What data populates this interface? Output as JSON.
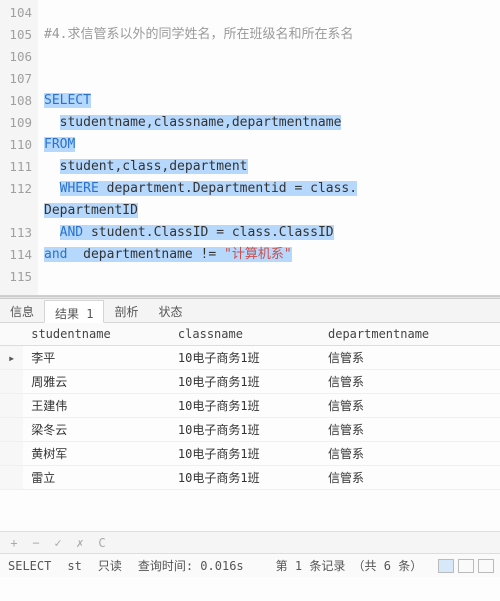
{
  "editor": {
    "lines": [
      {
        "n": 104,
        "tokens": []
      },
      {
        "n": 105,
        "tokens": [
          {
            "t": "#4.求信管系以外的同学姓名，所在班级名和所在系名",
            "cls": "comment"
          }
        ]
      },
      {
        "n": 106,
        "tokens": []
      },
      {
        "n": 107,
        "tokens": []
      },
      {
        "n": 108,
        "tokens": [
          {
            "t": "SELECT",
            "cls": "sel kw"
          }
        ]
      },
      {
        "n": 109,
        "tokens": [
          {
            "t": "  ",
            "cls": ""
          },
          {
            "t": "studentname,classname,departmentname",
            "cls": "sel"
          }
        ]
      },
      {
        "n": 110,
        "tokens": [
          {
            "t": "FROM",
            "cls": "sel kw"
          }
        ]
      },
      {
        "n": 111,
        "tokens": [
          {
            "t": "  ",
            "cls": ""
          },
          {
            "t": "student,class,department",
            "cls": "sel"
          }
        ]
      },
      {
        "n": 112,
        "tokens": [
          {
            "t": "  ",
            "cls": ""
          },
          {
            "t": "WHERE",
            "cls": "sel kw"
          },
          {
            "t": " department.Departmentid = class.",
            "cls": "sel"
          }
        ],
        "wrap": [
          {
            "t": "DepartmentID",
            "cls": "sel"
          }
        ]
      },
      {
        "n": 113,
        "tokens": [
          {
            "t": "  ",
            "cls": ""
          },
          {
            "t": "AND",
            "cls": "sel kw"
          },
          {
            "t": " student.ClassID = class.ClassID",
            "cls": "sel"
          }
        ]
      },
      {
        "n": 114,
        "tokens": [
          {
            "t": "and",
            "cls": "sel kw"
          },
          {
            "t": "  departmentname != ",
            "cls": "sel"
          },
          {
            "t": "\"计算机系\"",
            "cls": "sel str"
          }
        ]
      },
      {
        "n": 115,
        "tokens": []
      }
    ]
  },
  "tabs": {
    "items": [
      "信息",
      "结果 1",
      "剖析",
      "状态"
    ],
    "active_index": 1
  },
  "grid": {
    "columns": [
      "studentname",
      "classname",
      "departmentname"
    ],
    "rows": [
      [
        "李平",
        "10电子商务1班",
        "信管系"
      ],
      [
        "周雅云",
        "10电子商务1班",
        "信管系"
      ],
      [
        "王建伟",
        "10电子商务1班",
        "信管系"
      ],
      [
        "梁冬云",
        "10电子商务1班",
        "信管系"
      ],
      [
        "黄树军",
        "10电子商务1班",
        "信管系"
      ],
      [
        "雷立",
        "10电子商务1班",
        "信管系"
      ]
    ],
    "selected_row": 0
  },
  "toolbar": {
    "add": "+",
    "remove": "−",
    "check": "✓",
    "cancel": "✗",
    "refresh": "C"
  },
  "status": {
    "stmt": "SELECT",
    "mode_prefix": "st",
    "mode": "只读",
    "query_label": "查询时间:",
    "query_time": "0.016s",
    "record_info": "第 1 条记录 （共 6 条）"
  }
}
